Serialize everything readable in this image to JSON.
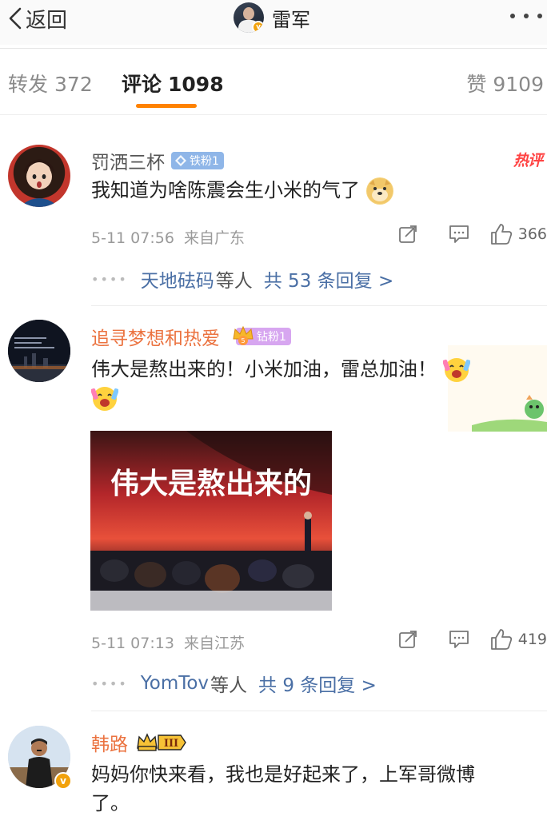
{
  "nav": {
    "back_label": "返回",
    "title": "雷军"
  },
  "tabs": [
    {
      "label": "转发",
      "count": "372"
    },
    {
      "label": "评论",
      "count": "1098"
    },
    {
      "label": "赞",
      "count": "9109"
    }
  ],
  "comments": [
    {
      "user": "罚洒三杯",
      "fan_badge": "铁粉1",
      "hot_tag": "热评",
      "text": "我知道为啥陈震会生小米的气了",
      "time": "5-11 07:56",
      "location": "来自广东",
      "likes": "366",
      "reply_users": "天地砝码",
      "reply_etc": "等人",
      "reply_total": "共 53 条回复 >"
    },
    {
      "user": "追寻梦想和热爱",
      "fan_badge": "钻粉1",
      "text": "伟大是熬出来的！小米加油，雷总加油！",
      "image_text": "伟大是熬出来的",
      "time": "5-11 07:13",
      "location": "来自江苏",
      "likes": "419",
      "reply_users": "YomTov",
      "reply_etc": "等人",
      "reply_total": "共 9 条回复 >"
    },
    {
      "user": "韩路",
      "vip_level": "III",
      "text_line1": "妈妈你快来看，我也是好起来了，上军哥微博",
      "text_line2": "了。"
    }
  ],
  "colors": {
    "accent_orange": "#ff8200",
    "username_orange": "#eb7340",
    "link_blue": "#4a6fa5",
    "hot_red": "#ff4444"
  }
}
